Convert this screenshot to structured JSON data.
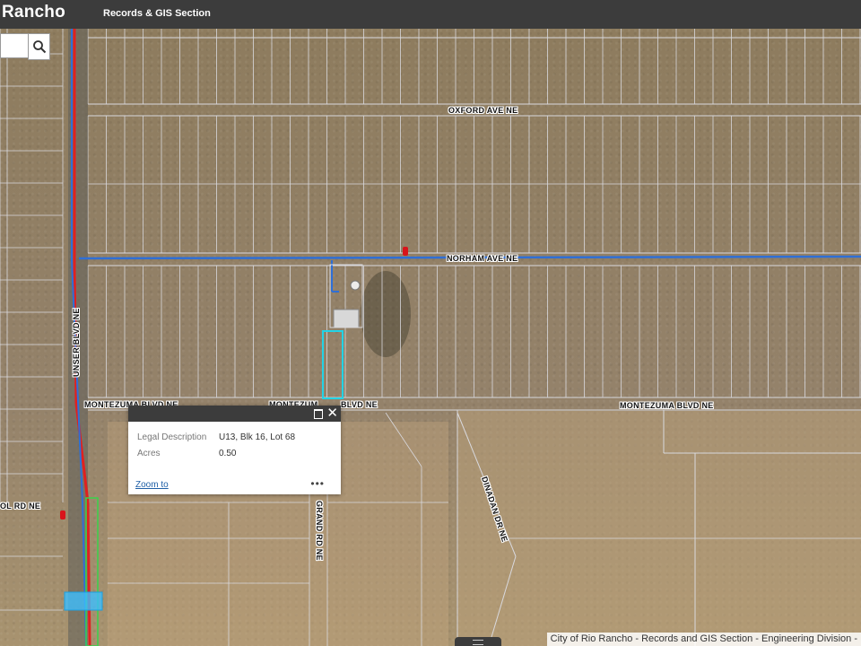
{
  "header": {
    "title": "Rancho",
    "subtitle": "Records & GIS Section"
  },
  "search": {
    "value": "",
    "placeholder": ""
  },
  "roads": {
    "oxford": "OXFORD AVE NE",
    "norham": "NORHAM AVE NE",
    "montezuma_left": "MONTEZUMA BLVD NE",
    "montezuma_mid": "MONTEZUM",
    "montezuma_mid_tail": "BLVD NE",
    "montezuma_right": "MONTEZUMA BLVD NE",
    "unser": "UNSER BLVD NE",
    "grand": "GRAND RD NE",
    "dinadan": "DINADAN DR NE",
    "ol_rd": "OL RD NE"
  },
  "popup": {
    "rows": [
      {
        "key": "Legal Description",
        "value": "U13, Blk 16, Lot 68"
      },
      {
        "key": "Acres",
        "value": "0.50"
      }
    ],
    "zoom_label": "Zoom to",
    "more_label": "•••",
    "close_label": "✕"
  },
  "attribution": "City of Rio Rancho - Records and GIS Section - Engineering Division -",
  "colors": {
    "header_bg": "#3c3c3c",
    "water_line": "#2f6fd6",
    "unser_red": "#e02020",
    "selection": "#22d3e6",
    "parcel_line": "#d9d9de",
    "link": "#1f5fa6"
  }
}
